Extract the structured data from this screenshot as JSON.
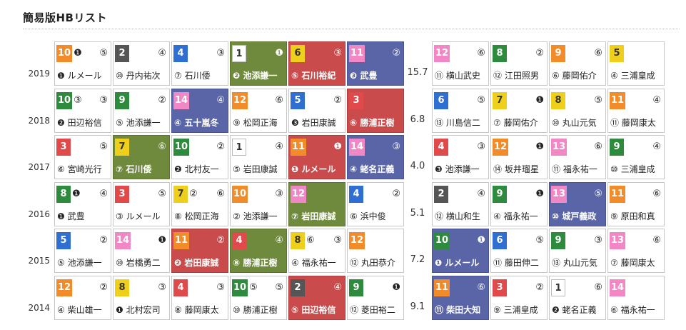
{
  "title": "簡易版HBリスト",
  "frame_colors": {
    "1": {
      "bg": "#ffffff",
      "fg": "#333333"
    },
    "2": {
      "bg": "#555555",
      "fg": "#ffffff"
    },
    "3": {
      "bg": "#e04a4a",
      "fg": "#ffffff"
    },
    "4": {
      "bg": "#2f6fd1",
      "fg": "#ffffff"
    },
    "5": {
      "bg": "#eecf1c",
      "fg": "#333333"
    },
    "6": {
      "bg": "#2e8b3d",
      "fg": "#ffffff"
    },
    "7": {
      "bg": "#f28b2a",
      "fg": "#ffffff"
    },
    "8": {
      "bg": "#f287c6",
      "fg": "#ffffff"
    }
  },
  "highlight_colors": {
    "g": "#6f8a3c",
    "r": "#c94b4b",
    "b": "#5a65a8"
  },
  "rows": [
    {
      "year": "2019",
      "divider": "15.7",
      "left": [
        {
          "num": "10",
          "frame": 7,
          "top": [
            "❶",
            "⑤"
          ],
          "name": "❶ ルメール"
        },
        {
          "num": "2",
          "frame": 2,
          "top": [
            "④"
          ],
          "name": "⑩ 丹内祐次"
        },
        {
          "num": "4",
          "frame": 4,
          "top": [
            "③"
          ],
          "name": "⑦ 石川倭"
        },
        {
          "num": "1",
          "frame": 1,
          "top": [
            "❶"
          ],
          "name": "❷ 池添謙一",
          "hl": "g"
        },
        {
          "num": "6",
          "frame": 5,
          "top": [
            "③"
          ],
          "name": "⑤ 石川裕紀",
          "hl": "r"
        },
        {
          "num": "11",
          "frame": 8,
          "top": [
            "②"
          ],
          "name": "❸ 武豊",
          "hl": "b"
        }
      ],
      "right": [
        {
          "num": "12",
          "frame": 8,
          "top": [
            "⑥"
          ],
          "name": "⑪ 横山武史"
        },
        {
          "num": "8",
          "frame": 6,
          "top": [
            "②"
          ],
          "name": "⑫ 江田照男"
        },
        {
          "num": "9",
          "frame": 7,
          "top": [
            "⑥"
          ],
          "name": "⑥ 藤岡佑介"
        },
        {
          "num": "5",
          "frame": 5,
          "top": [],
          "name": "④ 三浦皇成"
        }
      ]
    },
    {
      "year": "2018",
      "divider": "6.8",
      "left": [
        {
          "num": "10",
          "frame": 6,
          "top": [
            "③",
            "③"
          ],
          "name": "❷ 田辺裕信"
        },
        {
          "num": "9",
          "frame": 6,
          "top": [
            "②"
          ],
          "name": "⑤ 池添謙一"
        },
        {
          "num": "14",
          "frame": 8,
          "top": [
            "④"
          ],
          "name": "④ 五十嵐冬",
          "hl": "b"
        },
        {
          "num": "12",
          "frame": 7,
          "top": [
            "⑥"
          ],
          "name": "⑨ 松岡正海"
        },
        {
          "num": "5",
          "frame": 4,
          "top": [
            "②"
          ],
          "name": "❸ 岩田康誠"
        },
        {
          "num": "3",
          "frame": 3,
          "top": [],
          "name": "⑥ 勝浦正樹",
          "hl": "r"
        }
      ],
      "right": [
        {
          "num": "6",
          "frame": 4,
          "top": [
            "⑤"
          ],
          "name": "⑬ 川島信二"
        },
        {
          "num": "7",
          "frame": 5,
          "top": [
            "❶"
          ],
          "name": "⑦ 藤岡佑介"
        },
        {
          "num": "8",
          "frame": 5,
          "top": [
            "⑤"
          ],
          "name": "⑩ 丸山元気"
        },
        {
          "num": "11",
          "frame": 7,
          "top": [
            "④"
          ],
          "name": "⑪ 藤岡康太"
        }
      ]
    },
    {
      "year": "2017",
      "divider": "4.0",
      "left": [
        {
          "num": "3",
          "frame": 3,
          "top": [
            "⑤"
          ],
          "name": "⑥ 宮崎光行"
        },
        {
          "num": "7",
          "frame": 5,
          "top": [
            "⑥"
          ],
          "name": "⑦ 石川倭",
          "hl": "g"
        },
        {
          "num": "10",
          "frame": 6,
          "top": [
            "②"
          ],
          "name": "❷ 北村友一"
        },
        {
          "num": "1",
          "frame": 1,
          "top": [
            "④"
          ],
          "name": "⑤ 岩田康誠"
        },
        {
          "num": "11",
          "frame": 7,
          "top": [
            "❶"
          ],
          "name": "❶ ルメール",
          "hl": "r"
        },
        {
          "num": "14",
          "frame": 8,
          "top": [
            "③"
          ],
          "name": "④ 蛯名正義",
          "hl": "b"
        }
      ],
      "right": [
        {
          "num": "4",
          "frame": 3,
          "top": [
            "③"
          ],
          "name": "❸ 池添謙一"
        },
        {
          "num": "12",
          "frame": 7,
          "top": [
            "❶"
          ],
          "name": "⑭ 坂井瑠星"
        },
        {
          "num": "13",
          "frame": 8,
          "top": [
            "⑥"
          ],
          "name": "⑪ 福永祐一"
        },
        {
          "num": "9",
          "frame": 6,
          "top": [
            "④"
          ],
          "name": "⑩ 三浦皇成"
        }
      ]
    },
    {
      "year": "2016",
      "divider": "5.1",
      "left": [
        {
          "num": "8",
          "frame": 6,
          "top": [
            "❶",
            "④"
          ],
          "name": "❶ 武豊"
        },
        {
          "num": "3",
          "frame": 3,
          "top": [
            "⑤"
          ],
          "name": "③ ルメール"
        },
        {
          "num": "7",
          "frame": 5,
          "top": [
            "②",
            "⑥"
          ],
          "name": "⑧ 松岡正海"
        },
        {
          "num": "10",
          "frame": 7,
          "top": [
            "③"
          ],
          "name": "② 池添謙一"
        },
        {
          "num": "12",
          "frame": 8,
          "top": [],
          "name": "⑦ 岩田康誠",
          "hl": "g"
        },
        {
          "num": "4",
          "frame": 4,
          "top": [
            "②"
          ],
          "name": "⑥ 浜中俊"
        }
      ],
      "right": [
        {
          "num": "2",
          "frame": 2,
          "top": [
            "④"
          ],
          "name": "⑫ 横山和生"
        },
        {
          "num": "9",
          "frame": 6,
          "top": [
            "❶"
          ],
          "name": "④ 福永祐一"
        },
        {
          "num": "13",
          "frame": 8,
          "top": [
            "⑤"
          ],
          "name": "⑩ 城戸義政",
          "hl": "b"
        },
        {
          "num": "11",
          "frame": 7,
          "top": [
            "⑥"
          ],
          "name": "⑨ 原田和真"
        }
      ]
    },
    {
      "year": "2015",
      "divider": "7.2",
      "left": [
        {
          "num": "5",
          "frame": 4,
          "top": [
            "②"
          ],
          "name": "⑤ 池添謙一"
        },
        {
          "num": "14",
          "frame": 8,
          "top": [
            "❶"
          ],
          "name": "⑩ 岩橋勇二"
        },
        {
          "num": "11",
          "frame": 7,
          "top": [
            "②"
          ],
          "name": "❷ 岩田康誠",
          "hl": "r"
        },
        {
          "num": "4",
          "frame": 3,
          "top": [
            "④"
          ],
          "name": "⑧ 勝浦正樹",
          "hl": "g"
        },
        {
          "num": "8",
          "frame": 5,
          "top": [
            "⑥",
            "③"
          ],
          "name": "④ 福永祐一"
        },
        {
          "num": "12",
          "frame": 7,
          "top": [],
          "name": "⑫ 丸田恭介"
        }
      ],
      "right": [
        {
          "num": "10",
          "frame": 6,
          "top": [
            "❶"
          ],
          "name": "❶ ルメール",
          "hl": "b"
        },
        {
          "num": "6",
          "frame": 4,
          "top": [
            "⑤"
          ],
          "name": "⑪ 藤田伸二"
        },
        {
          "num": "9",
          "frame": 6,
          "top": [
            "③"
          ],
          "name": "⑬ 丸山元気"
        },
        {
          "num": "13",
          "frame": 8,
          "top": [
            "⑥"
          ],
          "name": "⑦ 藤岡康太"
        }
      ]
    },
    {
      "year": "2014",
      "divider": "9.1",
      "left": [
        {
          "num": "12",
          "frame": 7,
          "top": [
            "②"
          ],
          "name": "④ 柴山雄一"
        },
        {
          "num": "8",
          "frame": 5,
          "top": [
            "③"
          ],
          "name": "❶ 北村宏司"
        },
        {
          "num": "4",
          "frame": 3,
          "top": [
            "③"
          ],
          "name": "⑧ 藤岡康太"
        },
        {
          "num": "10",
          "frame": 6,
          "top": [
            "⑤",
            "⑤"
          ],
          "name": "⑩ 勝浦正樹"
        },
        {
          "num": "2",
          "frame": 2,
          "top": [
            "④"
          ],
          "name": "⑤ 田辺裕信",
          "hl": "r"
        },
        {
          "num": "9",
          "frame": 6,
          "top": [
            "❶"
          ],
          "name": "⑫ 菱田裕二"
        }
      ],
      "right": [
        {
          "num": "11",
          "frame": 7,
          "top": [
            "⑥"
          ],
          "name": "⑪ 柴田大知",
          "hl": "b"
        },
        {
          "num": "3",
          "frame": 3,
          "top": [
            "②"
          ],
          "name": "⑨ 三浦皇成"
        },
        {
          "num": "1",
          "frame": 1,
          "top": [
            "⑥"
          ],
          "name": "❷ 蛯名正義"
        },
        {
          "num": "14",
          "frame": 8,
          "top": [],
          "name": "⑥ 福永祐一"
        }
      ]
    }
  ]
}
